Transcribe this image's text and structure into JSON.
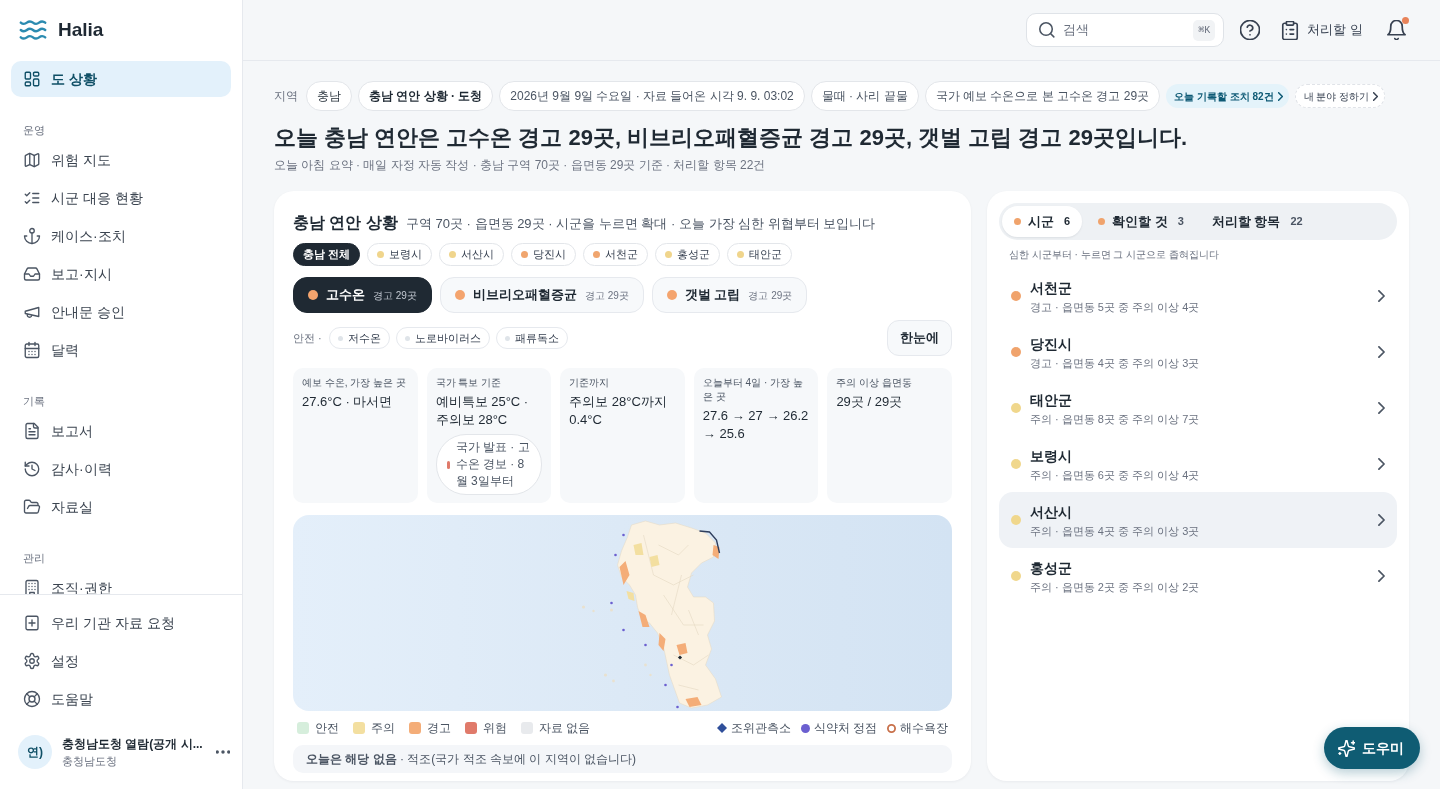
{
  "sidebar": {
    "brand": "Halia",
    "sections": [
      {
        "items": [
          {
            "label": "도 상황",
            "selected": true
          }
        ]
      },
      {
        "heading": "운영",
        "items": [
          {
            "label": "위험 지도",
            "selected": false
          },
          {
            "label": "시군 대응 현황",
            "selected": false
          },
          {
            "label": "케이스·조치",
            "selected": false
          },
          {
            "label": "보고·지시",
            "selected": false
          },
          {
            "label": "안내문 승인",
            "selected": false
          },
          {
            "label": "달력",
            "selected": false
          }
        ]
      },
      {
        "heading": "기록",
        "items": [
          {
            "label": "보고서",
            "selected": false
          },
          {
            "label": "감사·이력",
            "selected": false
          },
          {
            "label": "자료실",
            "selected": false
          }
        ]
      },
      {
        "heading": "관리",
        "items": [
          {
            "label": "조직·권한",
            "selected": false
          }
        ]
      }
    ],
    "footer_items": [
      {
        "label": "우리 기관 자료 요청",
        "selected": false
      },
      {
        "label": "설정",
        "selected": false
      },
      {
        "label": "도움말",
        "selected": false
      }
    ],
    "user": {
      "avatar": "연)",
      "name": "충청남도청 열람(공개 시...",
      "org": "충청남도청"
    }
  },
  "header": {
    "search": {
      "placeholder": "검색",
      "shortcut": "⌘K"
    },
    "tasks": "처리할 일",
    "notifications": {
      "unread": true
    }
  },
  "context": {
    "label": "지역",
    "chips": [
      {
        "kind": "plain",
        "text": "충남"
      },
      {
        "kind": "strong",
        "text": "충남 연안 상황 · 도청"
      },
      {
        "kind": "muted",
        "text": "2026년 9월 9일 수요일 · 자료 들어온 시각 9. 9. 03:02"
      },
      {
        "kind": "muted",
        "text": "물때 · 사리 끝물"
      },
      {
        "kind": "muted",
        "text": "국가 예보 수온으로 본 고수온 경고 29곳"
      },
      {
        "kind": "link",
        "text": "오늘 기록할 조치 82건"
      },
      {
        "kind": "setup",
        "text": "내 분야 정하기"
      }
    ]
  },
  "headline": "오늘 충남 연안은 고수온 경고 29곳, 비브리오패혈증균 경고 29곳, 갯벌 고립 경고 29곳입니다.",
  "summary": "오늘 아침 요약 · 매일 자정 자동 작성 · 충남 구역 70곳 · 읍면동 29곳 기준 · 처리할 항목 22건",
  "overview": {
    "title": "충남 연안 상황",
    "subtitle": "구역 70곳 · 읍면동 29곳 · 시군을 누르면 확대 · 오늘 가장 심한 위협부터 보입니다",
    "regions": [
      {
        "label": "충남 전체",
        "selected": true
      },
      {
        "label": "보령시",
        "color": "#f0d58c",
        "selected": false
      },
      {
        "label": "서산시",
        "color": "#f0d58c",
        "selected": false
      },
      {
        "label": "당진시",
        "color": "#f0a56e",
        "selected": false
      },
      {
        "label": "서천군",
        "color": "#f0a56e",
        "selected": false
      },
      {
        "label": "홍성군",
        "color": "#f0d58c",
        "selected": false
      },
      {
        "label": "태안군",
        "color": "#f0d58c",
        "selected": false
      }
    ],
    "hazards": [
      {
        "label": "고수온",
        "count": "경고 29곳",
        "color": "#f4a46e",
        "selected": true
      },
      {
        "label": "비브리오패혈증균",
        "count": "경고 29곳",
        "color": "#f4a46e",
        "selected": false
      },
      {
        "label": "갯벌 고립",
        "count": "경고 29곳",
        "color": "#f4a46e",
        "selected": false
      }
    ],
    "safe": {
      "label": "안전 ·",
      "items": [
        "저수온",
        "노로바이러스",
        "패류독소"
      ]
    },
    "glance_button": "한눈에",
    "stats": [
      {
        "label": "예보 수온, 가장 높은 곳",
        "value": "27.6°C · 마서면"
      },
      {
        "label": "국가 특보 기준",
        "value": "예비특보 25°C · 주의보 28°C",
        "notice": "국가 발표 · 고수온 경보 · 8월 3일부터"
      },
      {
        "label": "기준까지",
        "value": "주의보 28°C까지 0.4°C"
      },
      {
        "label": "오늘부터 4일 · 가장 높은 곳",
        "value": "27.6 → 27 → 26.2 → 25.6"
      },
      {
        "label": "주의 이상 읍면동",
        "value": "29곳 / 29곳"
      }
    ],
    "legend": [
      {
        "label": "안전",
        "color": "#d6eedc"
      },
      {
        "label": "주의",
        "color": "#f3dfa0"
      },
      {
        "label": "경고",
        "color": "#f4ad78"
      },
      {
        "label": "위험",
        "color": "#e07a6a"
      },
      {
        "label": "자료 없음",
        "color": "#e8eaed"
      }
    ],
    "markers": [
      {
        "kind": "diamond",
        "label": "조위관측소"
      },
      {
        "kind": "dot",
        "label": "식약처 정점"
      },
      {
        "kind": "ring",
        "label": "해수욕장"
      }
    ],
    "note": "**오늘은 해당 없음** · 적조(국가 적조 속보에 이 지역이 없습니다)"
  },
  "side_panel": {
    "tabs": [
      {
        "label": "시군",
        "count": "6",
        "color": "#f0a36c",
        "selected": true
      },
      {
        "label": "확인할 것",
        "count": "3",
        "color": "#f0a36c",
        "selected": false
      },
      {
        "label": "처리할 항목",
        "count": "22",
        "selected": false
      }
    ],
    "hint": "심한 시군부터 · 누르면 그 시군으로 좁혀집니다",
    "rows": [
      {
        "name": "서천군",
        "detail": "경고 · 읍면동 5곳 중 주의 이상 4곳",
        "color": "#f0a36c",
        "highlighted": false
      },
      {
        "name": "당진시",
        "detail": "경고 · 읍면동 4곳 중 주의 이상 3곳",
        "color": "#f0a36c",
        "highlighted": false
      },
      {
        "name": "태안군",
        "detail": "주의 · 읍면동 8곳 중 주의 이상 7곳",
        "color": "#f0d78c",
        "highlighted": false
      },
      {
        "name": "보령시",
        "detail": "주의 · 읍면동 6곳 중 주의 이상 4곳",
        "color": "#f0d78c",
        "highlighted": false
      },
      {
        "name": "서산시",
        "detail": "주의 · 읍면동 4곳 중 주의 이상 3곳",
        "color": "#f0d78c",
        "highlighted": true
      },
      {
        "name": "홍성군",
        "detail": "주의 · 읍면동 2곳 중 주의 이상 2곳",
        "color": "#f0d78c",
        "highlighted": false
      }
    ]
  },
  "assistant_button": "도우미"
}
